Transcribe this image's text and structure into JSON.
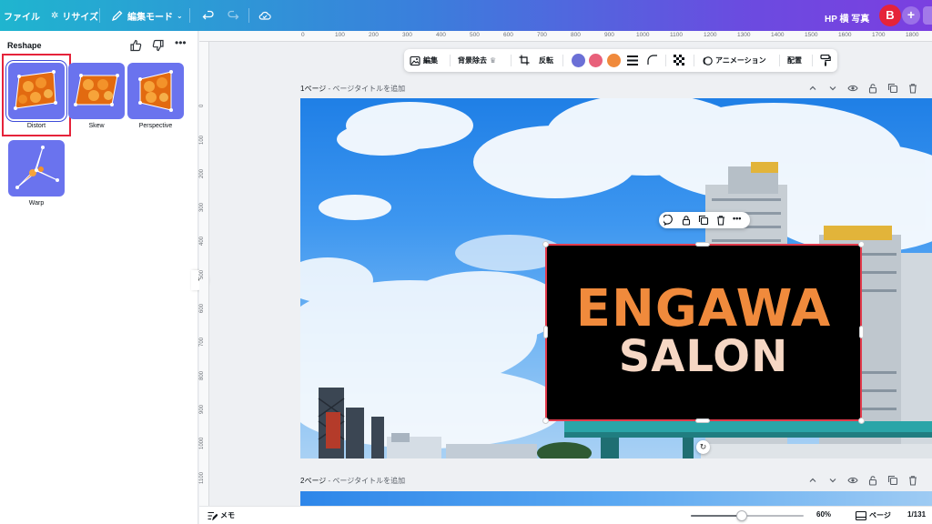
{
  "topbar": {
    "file": "ファイル",
    "resize": "リサイズ",
    "edit_mode": "編集モード",
    "doc_title": "HP 横 写真",
    "avatar_letter": "B",
    "plus": "+"
  },
  "panel": {
    "title": "Reshape",
    "options": [
      {
        "label": "Distort",
        "selected": true
      },
      {
        "label": "Skew"
      },
      {
        "label": "Perspective"
      },
      {
        "label": "Warp"
      }
    ],
    "collapse": "‹"
  },
  "ruler": {
    "top": [
      "0",
      "100",
      "200",
      "300",
      "400",
      "500",
      "600",
      "700",
      "800",
      "900",
      "1000",
      "1100",
      "1200",
      "1300",
      "1400",
      "1500",
      "1600",
      "1700",
      "1800"
    ],
    "left": [
      "0",
      "100",
      "200",
      "300",
      "400",
      "500",
      "600",
      "700",
      "800",
      "900",
      "1000",
      "1100"
    ]
  },
  "toolbar": {
    "edit": "編集",
    "bg_remove": "背景除去",
    "flip": "反転",
    "animation": "アニメーション",
    "arrange": "配置",
    "colors": [
      "#6b70d6",
      "#e8607a",
      "#f08a3c"
    ]
  },
  "pages": [
    {
      "number": "1ページ",
      "title_placeholder": "ページタイトルを追加"
    },
    {
      "number": "2ページ",
      "title_placeholder": "ページタイトルを追加"
    }
  ],
  "canvas": {
    "sign_line1": "ENGAWA",
    "sign_line2": "SALON"
  },
  "bottombar": {
    "notes": "メモ",
    "zoom": "60%",
    "zoom_fraction": 0.45,
    "pages": "ページ",
    "page_count": "1/131"
  },
  "colors": {
    "accent_red": "#e5233a",
    "tile_bg": "#6a73ee"
  }
}
